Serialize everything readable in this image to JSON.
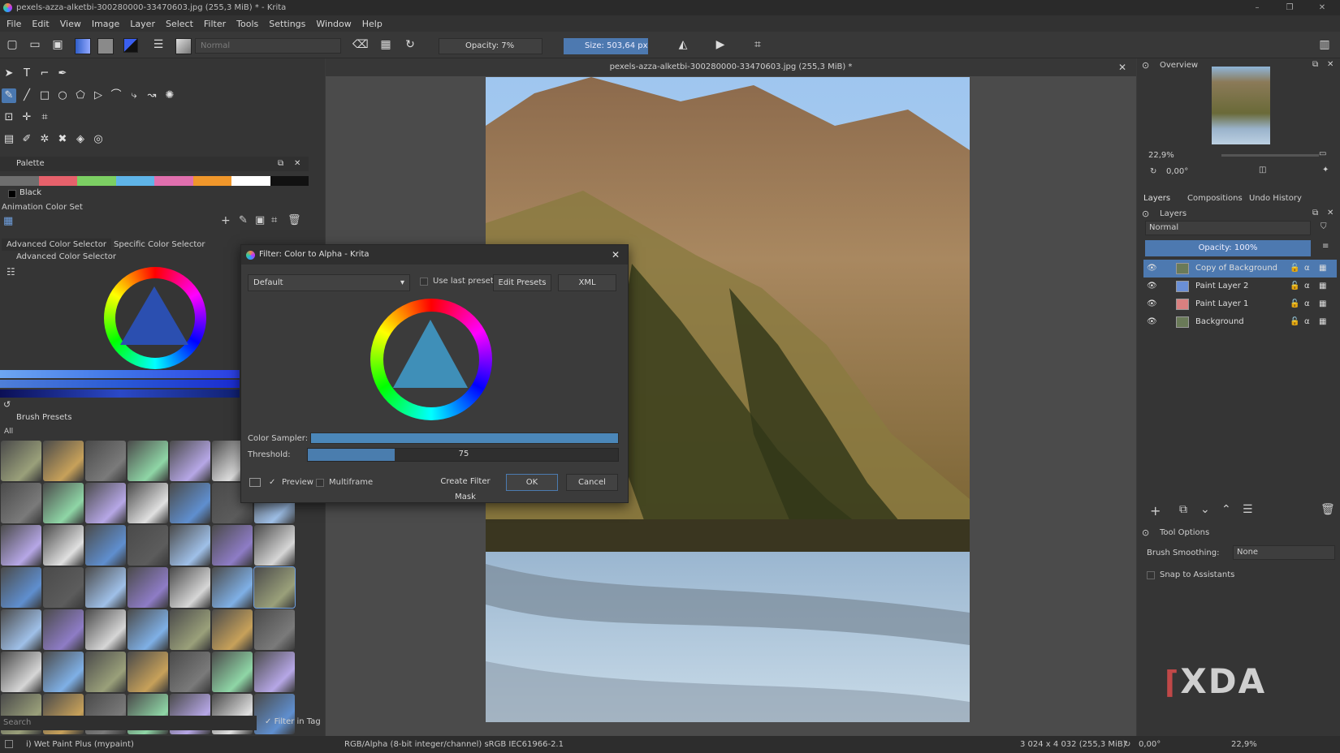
{
  "window": {
    "title": "pexels-azza-alketbi-300280000-33470603.jpg (255,3 MiB) * - Krita"
  },
  "menu": [
    "File",
    "Edit",
    "View",
    "Image",
    "Layer",
    "Select",
    "Filter",
    "Tools",
    "Settings",
    "Window",
    "Help"
  ],
  "toolbar": {
    "blend_mode": "Normal",
    "opacity": "Opacity: 7%",
    "size": "Size: 503,64 px"
  },
  "left": {
    "palette_title": "Palette",
    "palette_colors": [
      "#6e6e6e",
      "#e6616b",
      "#7ccf63",
      "#5fb4e8",
      "#e06fae",
      "#f0972b",
      "#ffffff",
      "#111111"
    ],
    "current_color_name": "Black",
    "color_set": "Animation Color Set",
    "tabs": [
      "Advanced Color Selector",
      "Specific Color Selector"
    ],
    "selector_title": "Advanced Color Selector",
    "brush_presets_title": "Brush Presets",
    "brush_tag": "All",
    "search_placeholder": "Search",
    "filter_in_tag": "Filter in Tag"
  },
  "document": {
    "tab_title": "pexels-azza-alketbi-300280000-33470603.jpg (255,3 MiB) *"
  },
  "dialog": {
    "title": "Filter: Color to Alpha - Krita",
    "preset": "Default",
    "use_last_preset": "Use last preset",
    "edit_presets": "Edit Presets",
    "xml": "XML",
    "color_sampler_label": "Color Sampler:",
    "threshold_label": "Threshold:",
    "threshold_value": "75",
    "threshold_fraction": 0.28,
    "preview": "Preview",
    "multiframe": "Multiframe",
    "create_mask": "Create Filter Mask",
    "ok": "OK",
    "cancel": "Cancel"
  },
  "right": {
    "overview_title": "Overview",
    "zoom": "22,9%",
    "rotation": "0,00°",
    "tabs": [
      "Layers",
      "Compositions",
      "Undo History"
    ],
    "layers_title": "Layers",
    "blend": "Normal",
    "opacity": "Opacity:  100%",
    "layers": [
      "Copy of Background",
      "Paint Layer 2",
      "Paint Layer 1",
      "Background"
    ],
    "tool_options_title": "Tool Options",
    "brush_smoothing_label": "Brush Smoothing:",
    "brush_smoothing_value": "None",
    "snap_label": "Snap to Assistants"
  },
  "status": {
    "brush": "i) Wet Paint Plus (mypaint)",
    "colorspace": "RGB/Alpha (8-bit integer/channel)  sRGB IEC61966-2.1",
    "dimensions": "3 024 x 4 032 (255,3 MiB)",
    "rotation": "0,00°",
    "zoom": "22,9%"
  },
  "watermark": "XDA"
}
